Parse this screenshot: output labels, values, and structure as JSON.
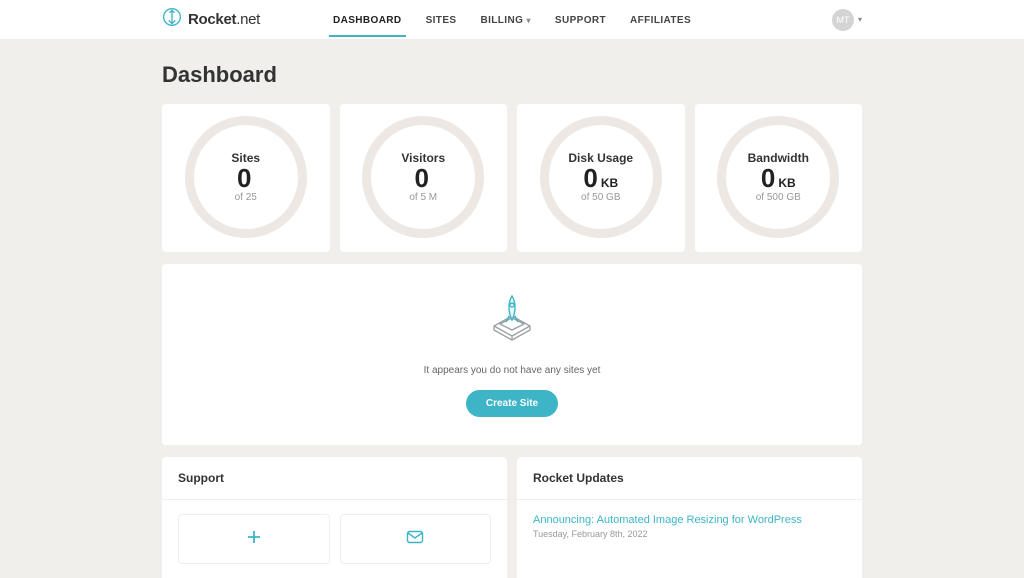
{
  "brand": {
    "name_bold": "Rocket",
    "name_thin": ".net"
  },
  "nav": {
    "dashboard": "DASHBOARD",
    "sites": "SITES",
    "billing": "BILLING",
    "support": "SUPPORT",
    "affiliates": "AFFILIATES"
  },
  "user": {
    "initials": "MT"
  },
  "page": {
    "title": "Dashboard"
  },
  "stats": {
    "sites": {
      "label": "Sites",
      "value": "0",
      "unit": "",
      "sub": "of 25"
    },
    "visitors": {
      "label": "Visitors",
      "value": "0",
      "unit": "",
      "sub": "of 5 M"
    },
    "disk": {
      "label": "Disk Usage",
      "value": "0",
      "unit": "KB",
      "sub": "of 50 GB"
    },
    "bandwidth": {
      "label": "Bandwidth",
      "value": "0",
      "unit": "KB",
      "sub": "of 500 GB"
    }
  },
  "empty": {
    "message": "It appears you do not have any sites yet",
    "button": "Create Site"
  },
  "panels": {
    "support": {
      "title": "Support"
    },
    "updates": {
      "title": "Rocket Updates",
      "item": {
        "headline": "Announcing: Automated Image Resizing for WordPress",
        "date": "Tuesday, February 8th, 2022"
      }
    }
  },
  "colors": {
    "accent": "#3db5c7"
  }
}
